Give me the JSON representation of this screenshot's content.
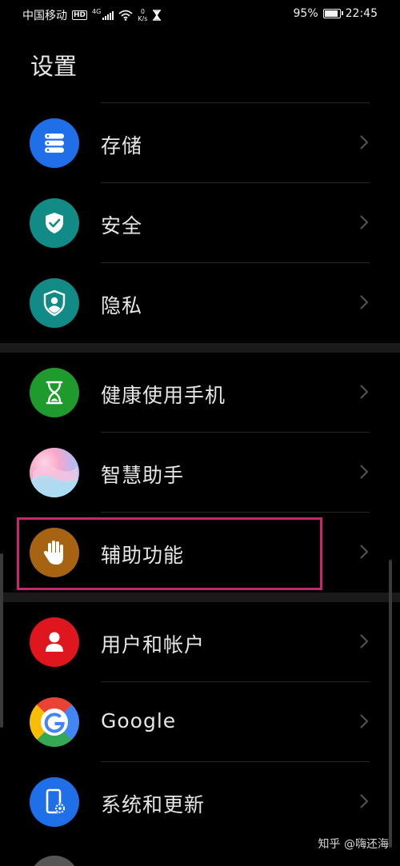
{
  "status_bar": {
    "carrier": "中国移动",
    "hd": "HD",
    "network": "4G",
    "speed_value": "0",
    "speed_unit": "K/s",
    "battery_percent": "95%",
    "battery_level": 0.95,
    "time": "22:45"
  },
  "header": {
    "title": "设置"
  },
  "settings": {
    "storage": {
      "label": "存储",
      "icon": "storage-icon",
      "color": "#1e6fe8"
    },
    "security": {
      "label": "安全",
      "icon": "shield-check-icon",
      "color": "#128a86"
    },
    "privacy": {
      "label": "隐私",
      "icon": "privacy-shield-icon",
      "color": "#128a86"
    },
    "digital_balance": {
      "label": "健康使用手机",
      "icon": "hourglass-icon",
      "color": "#1f9a2c"
    },
    "assistant": {
      "label": "智慧助手",
      "icon": "assistant-gradient-icon"
    },
    "accessibility": {
      "label": "辅助功能",
      "icon": "hand-icon",
      "color": "#a66312"
    },
    "accounts": {
      "label": "用户和帐户",
      "icon": "user-icon",
      "color": "#e0161e"
    },
    "google": {
      "label": "Google",
      "icon": "google-icon"
    },
    "system": {
      "label": "系统和更新",
      "icon": "phone-gear-icon",
      "color": "#1e6fe8"
    }
  },
  "highlight_color": "#c8266e",
  "watermark": "知乎 @嗨还海"
}
